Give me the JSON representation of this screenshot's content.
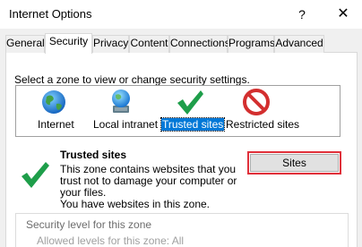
{
  "window": {
    "title": "Internet Options",
    "help_glyph": "?",
    "close_glyph": "✕"
  },
  "tabs": [
    "General",
    "Security",
    "Privacy",
    "Content",
    "Connections",
    "Programs",
    "Advanced"
  ],
  "active_tab": "Security",
  "zones": {
    "prompt": "Select a zone to view or change security settings.",
    "items": [
      {
        "label": "Internet",
        "icon": "globe-icon"
      },
      {
        "label": "Local intranet",
        "icon": "intranet-icon"
      },
      {
        "label": "Trusted sites",
        "icon": "checkmark-icon"
      },
      {
        "label": "Restricted sites",
        "icon": "restricted-icon"
      }
    ],
    "selected": "Trusted sites"
  },
  "zone_info": {
    "title": "Trusted sites",
    "description_line1": "This zone contains websites that you",
    "description_line2": "trust not to damage your computer or",
    "description_line3": "your files.",
    "description_line4": "You have websites in this zone."
  },
  "sites_button": "Sites",
  "security_level": {
    "legend": "Security level for this zone",
    "allowed": "Allowed levels for this zone: All"
  },
  "colors": {
    "selection": "#0078d7",
    "highlight": "#e0303a",
    "check": "#1e9e4a"
  }
}
